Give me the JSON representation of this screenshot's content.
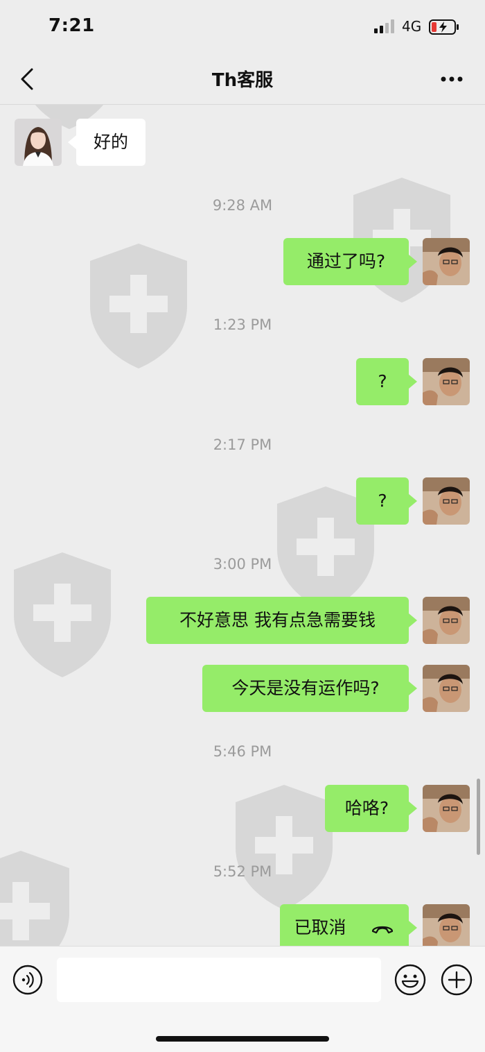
{
  "status_bar": {
    "time": "7:21",
    "network": "4G"
  },
  "header": {
    "title": "Th客服"
  },
  "messages": [
    {
      "type": "recv",
      "text": "好的"
    },
    {
      "type": "time",
      "text": "9:28 AM"
    },
    {
      "type": "sent",
      "text": "通过了吗?"
    },
    {
      "type": "time",
      "text": "1:23 PM"
    },
    {
      "type": "sent",
      "text": "?"
    },
    {
      "type": "time",
      "text": "2:17 PM"
    },
    {
      "type": "sent",
      "text": "?"
    },
    {
      "type": "time",
      "text": "3:00 PM"
    },
    {
      "type": "sent",
      "text": "不好意思 我有点急需要钱"
    },
    {
      "type": "sent",
      "text": "今天是没有运作吗?"
    },
    {
      "type": "time",
      "text": "5:46 PM"
    },
    {
      "type": "sent",
      "text": "哈咯?"
    },
    {
      "type": "time",
      "text": "5:52 PM"
    },
    {
      "type": "sent_call",
      "text": "已取消",
      "icon": "hangup-phone-icon"
    }
  ],
  "input": {
    "value": ""
  },
  "icons": [
    "back-arrow-icon",
    "more-dots-icon",
    "voice-icon",
    "emoji-icon",
    "plus-icon",
    "signal-icon",
    "battery-icon"
  ],
  "colors": {
    "sent_bubble": "#95ec69",
    "recv_bubble": "#ffffff",
    "background": "#ededed",
    "battery_low": "#e53935"
  }
}
